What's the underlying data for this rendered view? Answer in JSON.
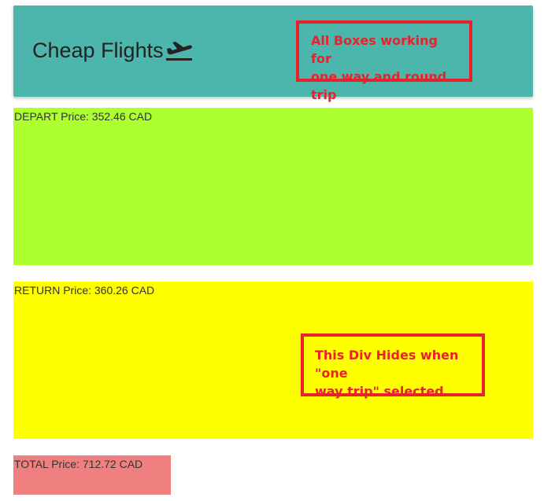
{
  "header": {
    "title": "Cheap Flights",
    "icon": "flight-takeoff-icon",
    "background_color": "#4db6ac"
  },
  "annotations": {
    "top": "All Boxes working for\none way and round trip",
    "bottom": "This Div Hides when \"one\nway trip\" selected",
    "color": "#e8212b"
  },
  "boxes": {
    "depart": {
      "text": "DEPART Price: 352.46 CAD",
      "color": "#adff2f"
    },
    "return": {
      "text": "RETURN Price: 360.26 CAD",
      "color": "#ffff00"
    },
    "total": {
      "text": "TOTAL Price: 712.72 CAD",
      "color": "#f08080"
    }
  }
}
